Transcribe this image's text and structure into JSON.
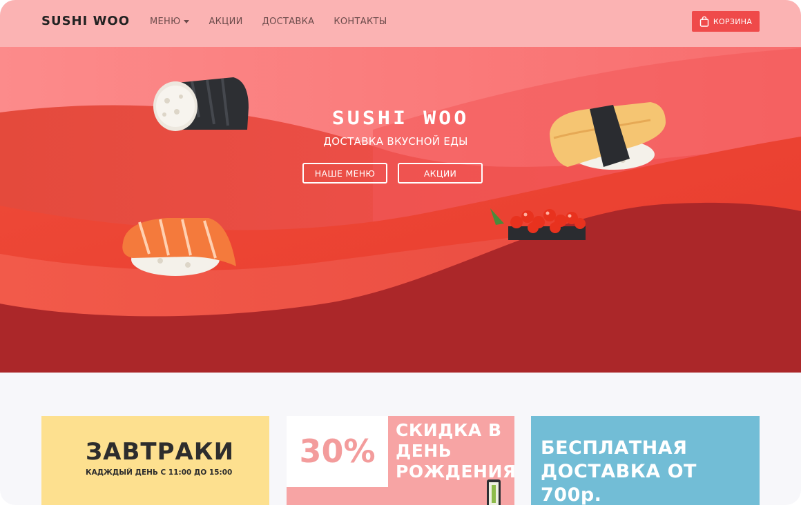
{
  "header": {
    "logo": "SUSHI WOO",
    "nav": [
      {
        "label": "МЕНЮ",
        "has_dropdown": true
      },
      {
        "label": "АКЦИИ"
      },
      {
        "label": "ДОСТАВКА"
      },
      {
        "label": "КОНТАКТЫ"
      }
    ],
    "cart_label": "КОРЗИНА",
    "cart_icon": "shopping-bag-icon"
  },
  "hero": {
    "title": "SUSHI WOO",
    "subtitle": "ДОСТАВКА ВКУСНОЙ ЕДЫ",
    "buttons": {
      "menu": "НАШЕ МЕНЮ",
      "promos": "АКЦИИ"
    }
  },
  "promos": {
    "breakfast": {
      "title": "ЗАВТРАКИ",
      "subtitle": "КАДЖДЫЙ ДЕНЬ С 11:00 ДО 15:00"
    },
    "birthday": {
      "percent": "30%",
      "line1": "СКИДКА В",
      "line2": "ДЕНЬ",
      "line3": "РОЖДЕНИЯ"
    },
    "delivery": {
      "line1": "БЕСПЛАТНАЯ",
      "line2": "ДОСТАВКА ОТ 700р."
    }
  },
  "colors": {
    "header_bg": "#fbb3b3",
    "accent": "#ef4a4a",
    "hero_dark": "#ab2729",
    "breakfast_bg": "#fde08f",
    "birthday_bg": "#f7a4a4",
    "delivery_bg": "#72bdd6"
  }
}
